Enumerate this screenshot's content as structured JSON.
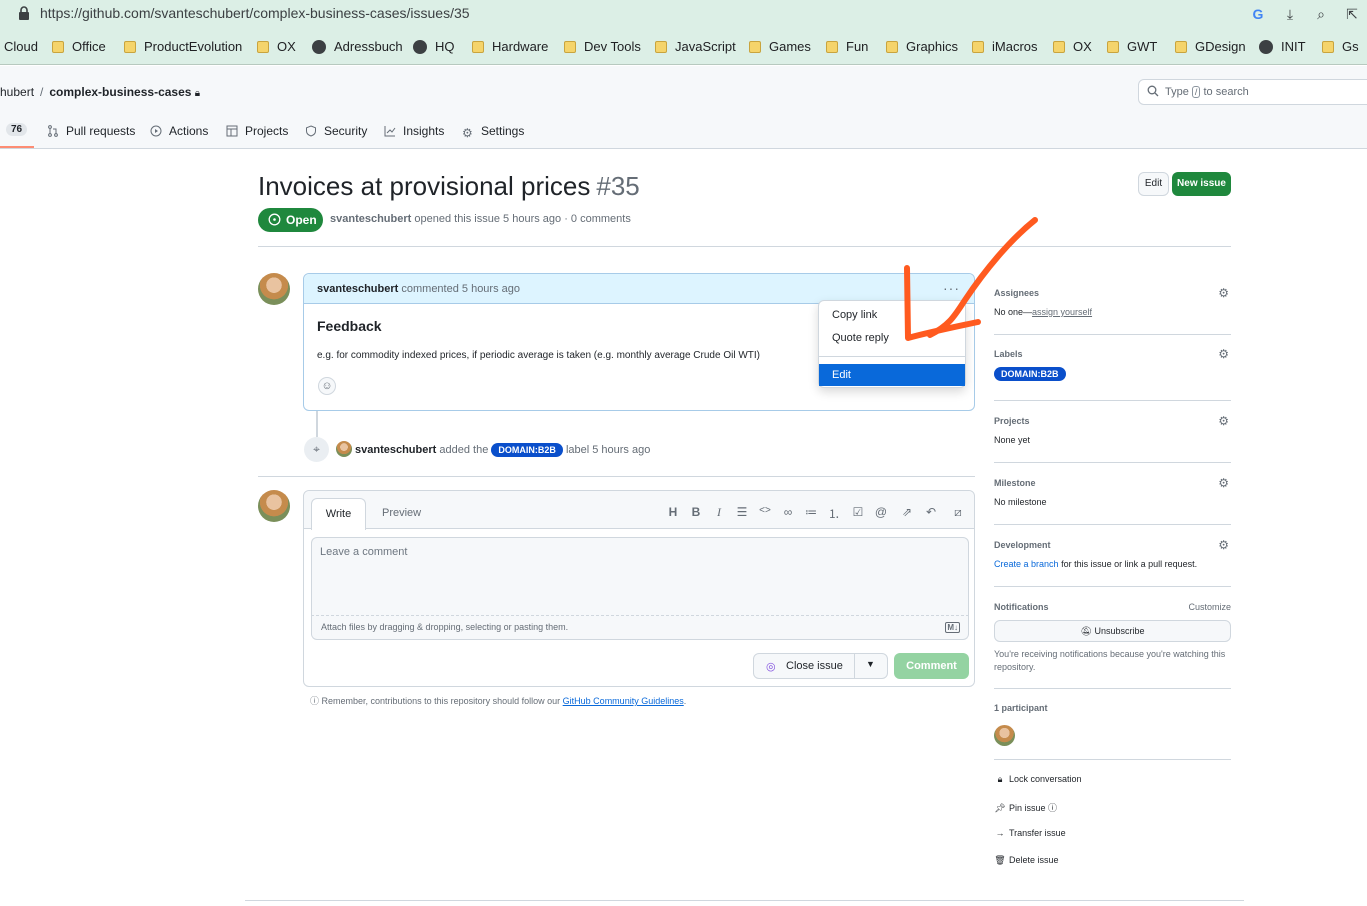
{
  "browser": {
    "url": "https://github.com/svanteschubert/complex-business-cases/issues/35",
    "bookmarks": [
      "Cloud",
      "Office",
      "ProductEvolution",
      "OX",
      "Adressbuch",
      "HQ",
      "Hardware",
      "Dev Tools",
      "JavaScript",
      "Games",
      "Fun",
      "Graphics",
      "iMacros",
      "OX",
      "GWT",
      "GDesign",
      "INIT",
      "Gs"
    ]
  },
  "repo": {
    "owner_partial": "hubert",
    "name": "complex-business-cases",
    "search_prefix": "Type",
    "search_key": "/",
    "search_suffix": "to search",
    "tabs": {
      "issues_count": "76",
      "pull_requests": "Pull requests",
      "actions": "Actions",
      "projects": "Projects",
      "security": "Security",
      "insights": "Insights",
      "settings": "Settings"
    }
  },
  "issue": {
    "title": "Invoices at provisional prices",
    "number": "#35",
    "edit_label": "Edit",
    "new_issue_label": "New issue",
    "state": "Open",
    "author": "svanteschubert",
    "meta_text": "opened this issue 5 hours ago · 0 comments"
  },
  "comment": {
    "author": "svanteschubert",
    "meta": "commented 5 hours ago",
    "heading": "Feedback",
    "body": "e.g. for commodity indexed prices, if periodic average is taken (e.g. monthly average Crude Oil WTI)",
    "menu": {
      "copy_link": "Copy link",
      "quote_reply": "Quote reply",
      "edit": "Edit"
    }
  },
  "event": {
    "actor": "svanteschubert",
    "text_before": "added the",
    "label": "DOMAIN:B2B",
    "text_after": "label 5 hours ago"
  },
  "form": {
    "write_tab": "Write",
    "preview_tab": "Preview",
    "placeholder": "Leave a comment",
    "attach_text": "Attach files by dragging & dropping, selecting or pasting them.",
    "md_badge": "M↓",
    "close_issue": "Close issue",
    "comment_button": "Comment",
    "remember_text": "Remember, contributions to this repository should follow our",
    "guidelines_link": "GitHub Community Guidelines",
    "remember_end": "."
  },
  "sidebar": {
    "assignees_title": "Assignees",
    "assignees_value": "No one—",
    "assign_yourself": "assign yourself",
    "labels_title": "Labels",
    "labels_value": "DOMAIN:B2B",
    "projects_title": "Projects",
    "projects_value": "None yet",
    "milestone_title": "Milestone",
    "milestone_value": "No milestone",
    "development_title": "Development",
    "development_link": "Create a branch",
    "development_rest": "for this issue or link a pull request.",
    "notifications_title": "Notifications",
    "customize": "Customize",
    "unsubscribe": "Unsubscribe",
    "notif_note": "You're receiving notifications because you're watching this repository.",
    "participants": "1 participant",
    "lock": "Lock conversation",
    "pin": "Pin issue",
    "transfer": "Transfer issue",
    "delete": "Delete issue"
  },
  "colors": {
    "green": "#1f883d",
    "label_blue": "#0a4fcb",
    "menu_highlight": "#0969da",
    "annotation_orange": "#ff5a1f"
  }
}
